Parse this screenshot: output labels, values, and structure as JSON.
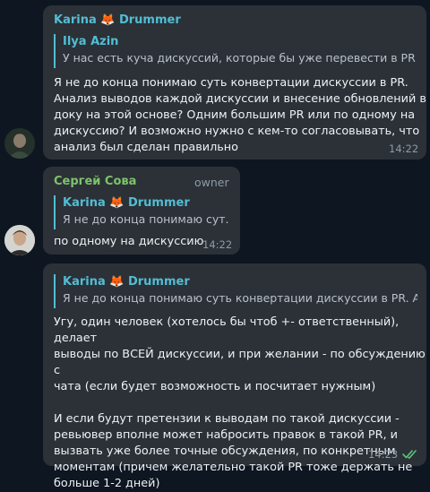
{
  "colors": {
    "background": "#0e1621",
    "bubble": "#2b3137",
    "accent": "#52bdd4",
    "sender_karina": "#52bdd4",
    "sender_sergey": "#7ec36a",
    "read_checks": "#5ec27b"
  },
  "messages": [
    {
      "sender": "Karina 🦊 Drummer",
      "reply": {
        "name": "Ilya Azin",
        "text": "У нас есть куча дискуссий, которые бы уже перевести в PR и з..."
      },
      "lines": [
        "Я не до конца понимаю суть конвертации дискуссии в PR.",
        "Анализ выводов каждой дискуссии и внесение обновлений в",
        "доку на этой основе? Одним большим PR или по одному на",
        "дискуссию? И возможно нужно с кем-то согласовывать, что",
        "анализ был сделан правильно"
      ],
      "time": "14:22",
      "avatar_icon": "user-avatar-icon"
    },
    {
      "sender": "Сергей Сова",
      "badge": "owner",
      "reply": {
        "name": "Karina 🦊 Drummer",
        "text": "Я не до конца понимаю сут..."
      },
      "text": "по одному на дискуссию",
      "time": "14:22",
      "avatar_icon": "user-avatar-icon"
    },
    {
      "reply": {
        "name": "Karina 🦊 Drummer",
        "text": "Я не до конца понимаю суть конвертации дискуссии в PR. Ан..."
      },
      "lines": [
        "Угу, один человек (хотелось бы чтоб +- ответственный), делает",
        "выводы по ВСЕЙ дискуссии, и при желании - по обсуждению с",
        "чата (если будет возможность и посчитает нужным)",
        "",
        "И если будут претензии к выводам по такой дискуссии -",
        "ревьювер вполне может набросить правок в такой PR, и",
        "вызвать уже более точные обсуждения, по конкретным",
        "моментам (причем желательно такой PR тоже держать не",
        "больше 1-2 дней)"
      ],
      "time": "14:23",
      "status_icon": "double-check-icon"
    }
  ]
}
